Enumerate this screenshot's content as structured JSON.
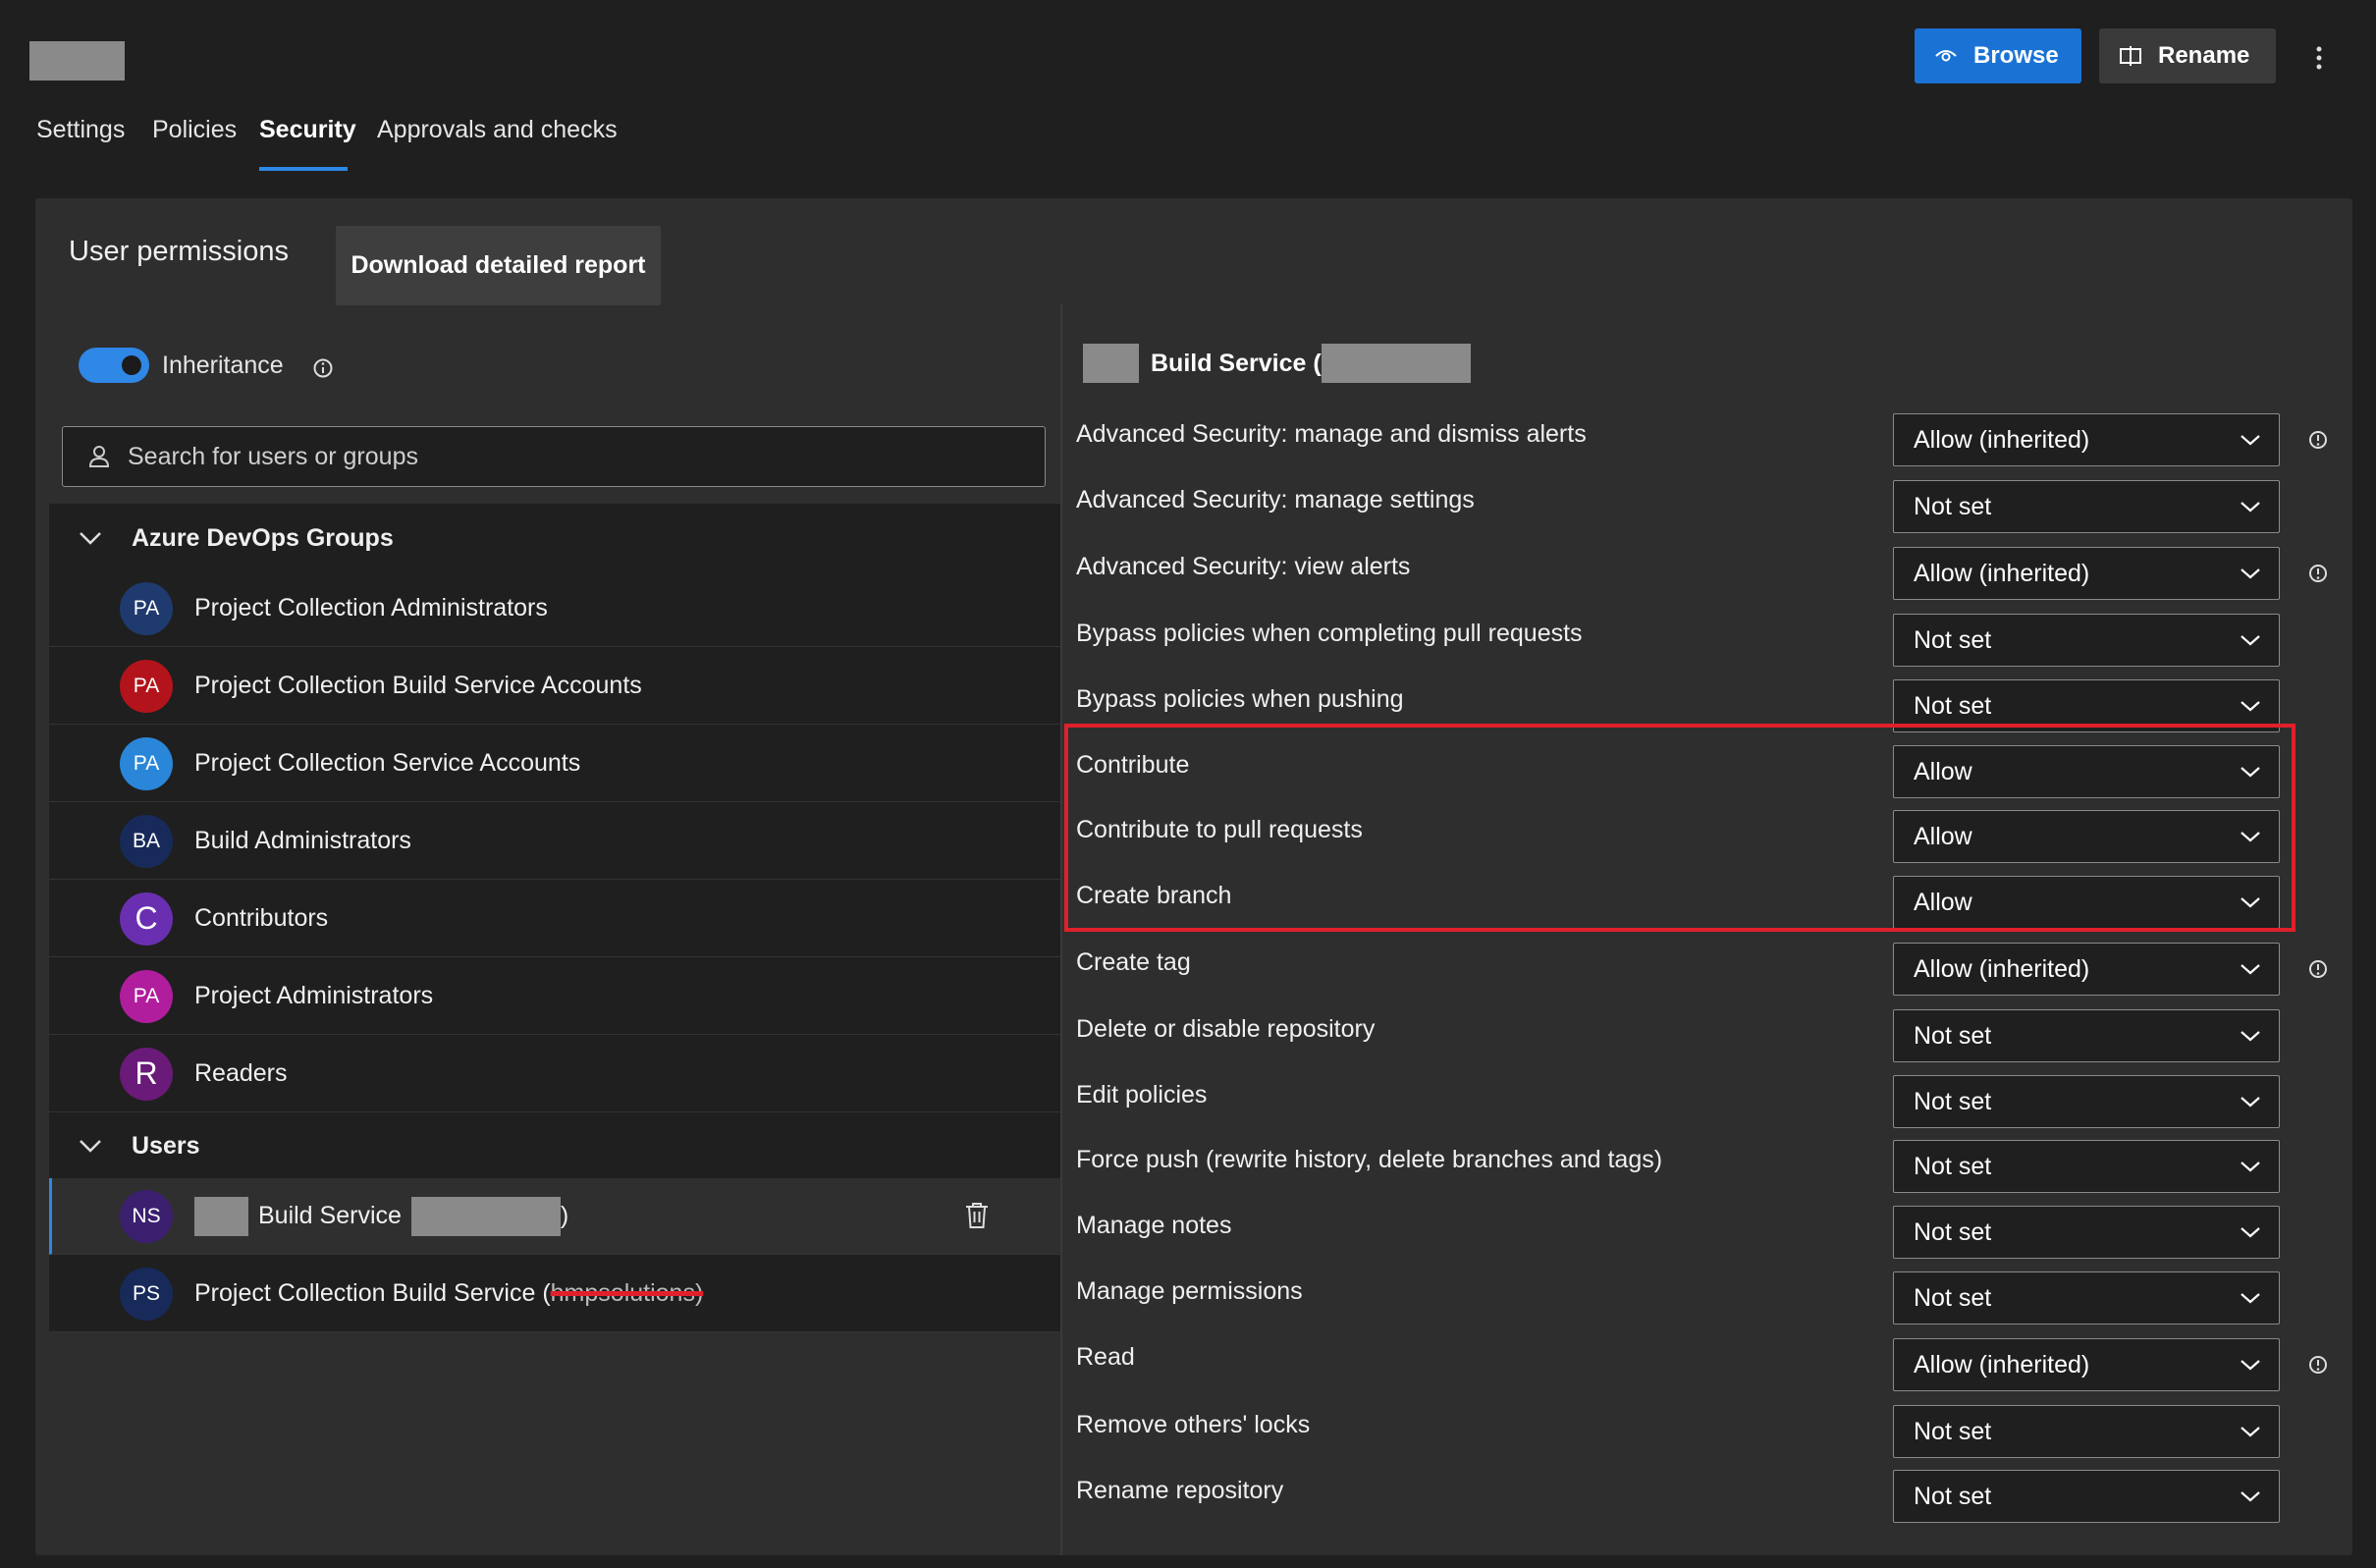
{
  "header": {
    "browse_label": "Browse",
    "rename_label": "Rename"
  },
  "tabs": [
    {
      "label": "Settings"
    },
    {
      "label": "Policies"
    },
    {
      "label": "Security",
      "active": true
    },
    {
      "label": "Approvals and checks"
    }
  ],
  "panel": {
    "title": "User permissions",
    "download_label": "Download detailed report",
    "inheritance_label": "Inheritance",
    "inheritance_on": true,
    "search_placeholder": "Search for users or groups"
  },
  "groups": {
    "header": "Azure DevOps Groups",
    "items": [
      {
        "initials": "PA",
        "name": "Project Collection Administrators",
        "color": "#1f3a6e"
      },
      {
        "initials": "PA",
        "name": "Project Collection Build Service Accounts",
        "color": "#b3141b"
      },
      {
        "initials": "PA",
        "name": "Project Collection Service Accounts",
        "color": "#2a86d8"
      },
      {
        "initials": "BA",
        "name": "Build Administrators",
        "color": "#172a5a"
      },
      {
        "initials": "C",
        "name": "Contributors",
        "color": "#6a2fb0"
      },
      {
        "initials": "PA",
        "name": "Project Administrators",
        "color": "#b01e9e"
      },
      {
        "initials": "R",
        "name": "Readers",
        "color": "#6a1a78"
      }
    ]
  },
  "users": {
    "header": "Users",
    "items": [
      {
        "initials": "NS",
        "name_prefix": "Build Service",
        "name_suffix": ")",
        "color": "#3b2070",
        "selected": true
      },
      {
        "initials": "PS",
        "name_prefix": "Project Collection Build Service (",
        "name_struck": "hmpsolutions)",
        "color": "#172a5a"
      }
    ]
  },
  "identity": {
    "title_prefix": "Build Service ("
  },
  "permissions": [
    {
      "name": "Advanced Security: manage and dismiss alerts",
      "value": "Allow (inherited)",
      "info": true
    },
    {
      "name": "Advanced Security: manage settings",
      "value": "Not set",
      "info": false
    },
    {
      "name": "Advanced Security: view alerts",
      "value": "Allow (inherited)",
      "info": true
    },
    {
      "name": "Bypass policies when completing pull requests",
      "value": "Not set",
      "info": false
    },
    {
      "name": "Bypass policies when pushing",
      "value": "Not set",
      "info": false
    },
    {
      "name": "Contribute",
      "value": "Allow",
      "info": false
    },
    {
      "name": "Contribute to pull requests",
      "value": "Allow",
      "info": false
    },
    {
      "name": "Create branch",
      "value": "Allow",
      "info": false
    },
    {
      "name": "Create tag",
      "value": "Allow (inherited)",
      "info": true
    },
    {
      "name": "Delete or disable repository",
      "value": "Not set",
      "info": false
    },
    {
      "name": "Edit policies",
      "value": "Not set",
      "info": false
    },
    {
      "name": "Force push (rewrite history, delete branches and tags)",
      "value": "Not set",
      "info": false
    },
    {
      "name": "Manage notes",
      "value": "Not set",
      "info": false
    },
    {
      "name": "Manage permissions",
      "value": "Not set",
      "info": false
    },
    {
      "name": "Read",
      "value": "Allow (inherited)",
      "info": true
    },
    {
      "name": "Remove others' locks",
      "value": "Not set",
      "info": false
    },
    {
      "name": "Rename repository",
      "value": "Not set",
      "info": false
    }
  ],
  "colors": {
    "accent": "#2f87e6",
    "highlight": "#e0202a"
  }
}
